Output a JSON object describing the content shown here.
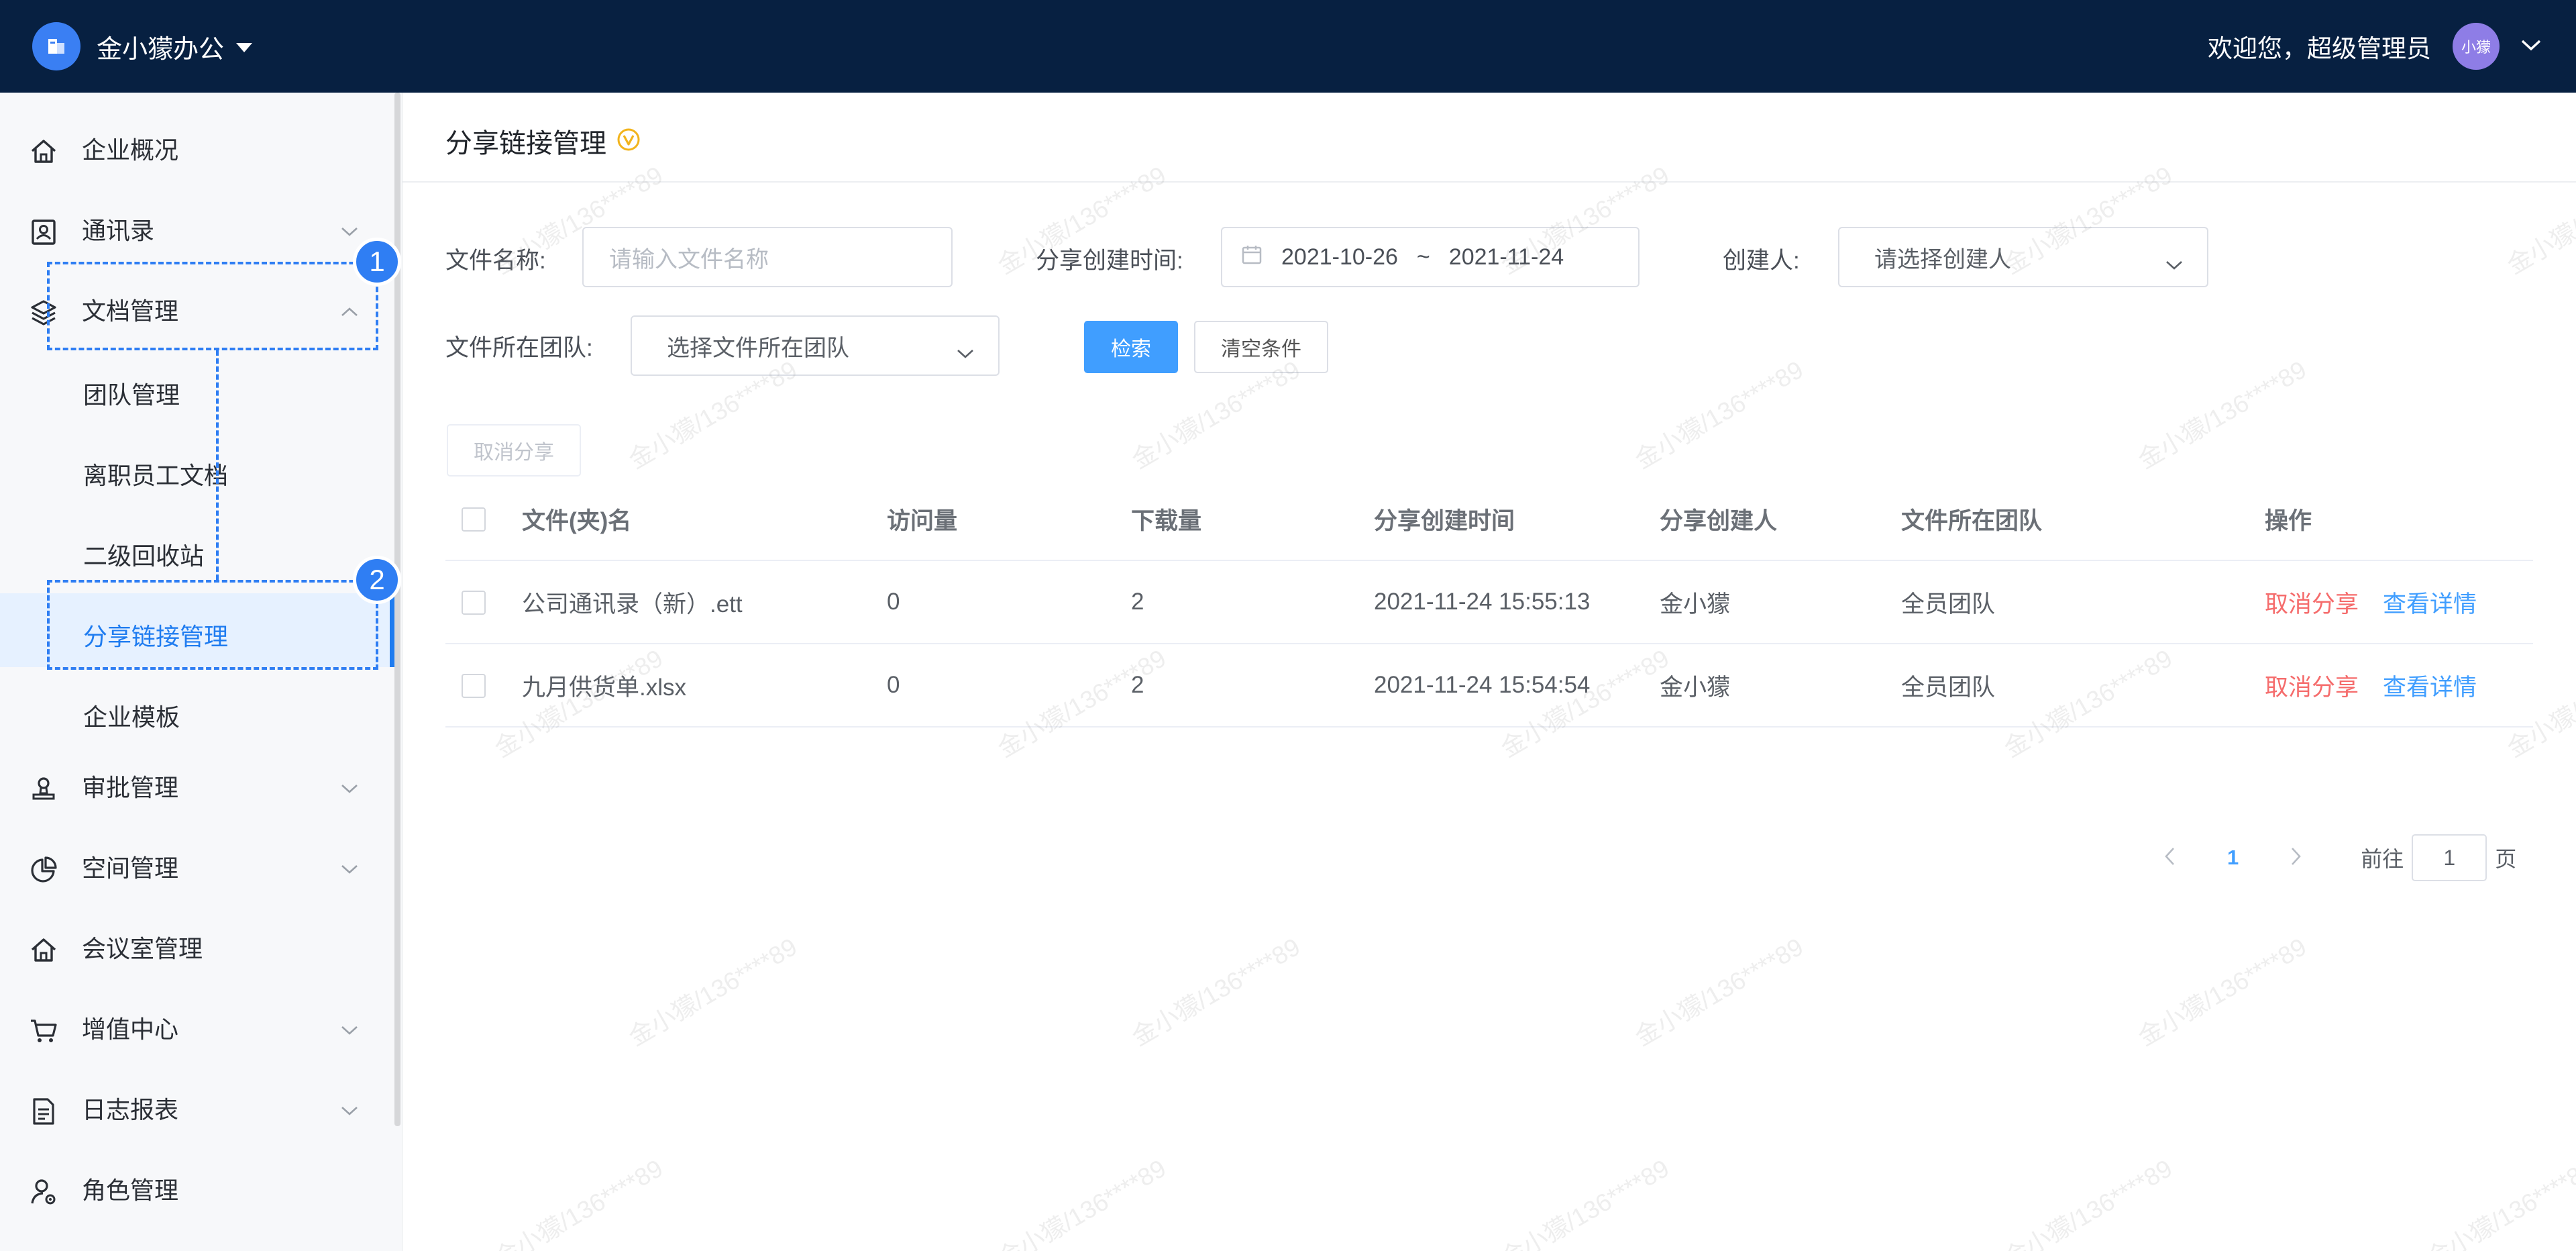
{
  "header": {
    "brand": "金小獴办公",
    "welcome": "欢迎您，超级管理员",
    "avatar_text": "小獴"
  },
  "sidebar": {
    "items": [
      {
        "label": "企业概况",
        "icon": "home-icon"
      },
      {
        "label": "通讯录",
        "icon": "contacts-icon"
      },
      {
        "label": "文档管理",
        "icon": "layers-icon"
      },
      {
        "label": "团队管理"
      },
      {
        "label": "离职员工文档"
      },
      {
        "label": "二级回收站"
      },
      {
        "label": "分享链接管理"
      },
      {
        "label": "企业模板"
      },
      {
        "label": "审批管理",
        "icon": "stamp-icon"
      },
      {
        "label": "空间管理",
        "icon": "pie-chart-icon"
      },
      {
        "label": "会议室管理",
        "icon": "home-icon"
      },
      {
        "label": "增值中心",
        "icon": "cart-icon"
      },
      {
        "label": "日志报表",
        "icon": "document-icon"
      },
      {
        "label": "角色管理",
        "icon": "user-settings-icon"
      }
    ],
    "badges": [
      "1",
      "2"
    ]
  },
  "page": {
    "title": "分享链接管理"
  },
  "filters": {
    "file_name_label": "文件名称:",
    "file_name_placeholder": "请输入文件名称",
    "share_time_label": "分享创建时间:",
    "date_start": "2021-10-26",
    "date_sep": "~",
    "date_end": "2021-11-24",
    "creator_label": "创建人:",
    "creator_placeholder": "请选择创建人",
    "team_label": "文件所在团队:",
    "team_placeholder": "选择文件所在团队",
    "search_button": "检索",
    "clear_button": "清空条件"
  },
  "toolbar": {
    "cancel_share_button": "取消分享"
  },
  "table": {
    "columns": [
      "文件(夹)名",
      "访问量",
      "下载量",
      "分享创建时间",
      "分享创建人",
      "文件所在团队",
      "操作"
    ],
    "rows": [
      {
        "name": "公司通讯录（新）.ett",
        "visits": "0",
        "downloads": "2",
        "created": "2021-11-24 15:55:13",
        "creator": "金小獴",
        "team": "全员团队",
        "action_cancel": "取消分享",
        "action_view": "查看详情"
      },
      {
        "name": "九月供货单.xlsx",
        "visits": "0",
        "downloads": "2",
        "created": "2021-11-24 15:54:54",
        "creator": "金小獴",
        "team": "全员团队",
        "action_cancel": "取消分享",
        "action_view": "查看详情"
      }
    ]
  },
  "pagination": {
    "current_page": "1",
    "goto_label": "前往",
    "goto_value": "1",
    "page_suffix": "页"
  },
  "watermark": "金小獴/136****89",
  "colors": {
    "topbar": "#072041",
    "accent": "#409eff",
    "danger": "#f56c6c",
    "annotation": "#2f7ef3"
  }
}
